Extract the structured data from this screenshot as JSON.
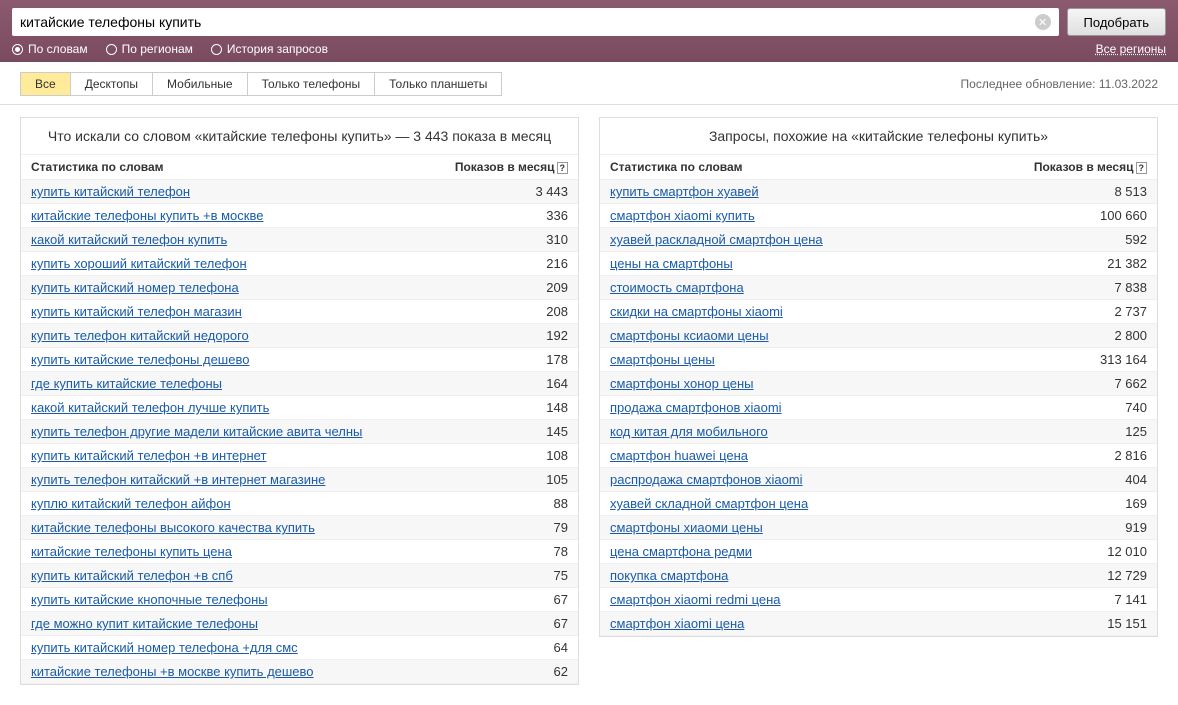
{
  "search": {
    "value": "китайские телефоны купить",
    "submit": "Подобрать"
  },
  "filters": {
    "words": "По словам",
    "regions": "По регионам",
    "history": "История запросов",
    "all_regions": "Все регионы"
  },
  "tabs": {
    "all": "Все",
    "desktops": "Десктопы",
    "mobiles": "Мобильные",
    "phones": "Только телефоны",
    "tablets": "Только планшеты"
  },
  "updated": "Последнее обновление: 11.03.2022",
  "left": {
    "title": "Что искали со словом «китайские телефоны купить» — 3 443 показа в месяц",
    "col_stat": "Статистика по словам",
    "col_count": "Показов в месяц",
    "rows": [
      {
        "q": "купить китайский телефон",
        "c": "3 443"
      },
      {
        "q": "китайские телефоны купить +в москве",
        "c": "336"
      },
      {
        "q": "какой китайский телефон купить",
        "c": "310"
      },
      {
        "q": "купить хороший китайский телефон",
        "c": "216"
      },
      {
        "q": "купить китайский номер телефона",
        "c": "209"
      },
      {
        "q": "купить китайский телефон магазин",
        "c": "208"
      },
      {
        "q": "купить телефон китайский недорого",
        "c": "192"
      },
      {
        "q": "купить китайские телефоны дешево",
        "c": "178"
      },
      {
        "q": "где купить китайские телефоны",
        "c": "164"
      },
      {
        "q": "какой китайский телефон лучше купить",
        "c": "148"
      },
      {
        "q": "купить телефон другие мадели китайские авита челны",
        "c": "145"
      },
      {
        "q": "купить китайский телефон +в интернет",
        "c": "108"
      },
      {
        "q": "купить телефон китайский +в интернет магазине",
        "c": "105"
      },
      {
        "q": "куплю китайский телефон айфон",
        "c": "88"
      },
      {
        "q": "китайские телефоны высокого качества купить",
        "c": "79"
      },
      {
        "q": "китайские телефоны купить цена",
        "c": "78"
      },
      {
        "q": "купить китайский телефон +в спб",
        "c": "75"
      },
      {
        "q": "купить китайские кнопочные телефоны",
        "c": "67"
      },
      {
        "q": "где можно купит китайские телефоны",
        "c": "67"
      },
      {
        "q": "купить китайский номер телефона +для смс",
        "c": "64"
      },
      {
        "q": "китайские телефоны +в москве купить дешево",
        "c": "62"
      }
    ]
  },
  "right": {
    "title": "Запросы, похожие на «китайские телефоны купить»",
    "col_stat": "Статистика по словам",
    "col_count": "Показов в месяц",
    "rows": [
      {
        "q": "купить смартфон хуавей",
        "c": "8 513"
      },
      {
        "q": "смартфон xiaomi купить",
        "c": "100 660"
      },
      {
        "q": "хуавей раскладной смартфон цена",
        "c": "592"
      },
      {
        "q": "цены на смартфоны",
        "c": "21 382"
      },
      {
        "q": "стоимость смартфона",
        "c": "7 838"
      },
      {
        "q": "скидки на смартфоны xiaomi",
        "c": "2 737"
      },
      {
        "q": "смартфоны ксиаоми цены",
        "c": "2 800"
      },
      {
        "q": "смартфоны цены",
        "c": "313 164"
      },
      {
        "q": "смартфоны хонор цены",
        "c": "7 662"
      },
      {
        "q": "продажа смартфонов xiaomi",
        "c": "740"
      },
      {
        "q": "код китая для мобильного",
        "c": "125"
      },
      {
        "q": "смартфон huawei цена",
        "c": "2 816"
      },
      {
        "q": "распродажа смартфонов xiaomi",
        "c": "404"
      },
      {
        "q": "хуавей складной смартфон цена",
        "c": "169"
      },
      {
        "q": "смартфоны хиаоми цены",
        "c": "919"
      },
      {
        "q": "цена смартфона редми",
        "c": "12 010"
      },
      {
        "q": "покупка смартфона",
        "c": "12 729"
      },
      {
        "q": "смартфон xiaomi redmi цена",
        "c": "7 141"
      },
      {
        "q": "смартфон xiaomi цена",
        "c": "15 151"
      }
    ]
  }
}
